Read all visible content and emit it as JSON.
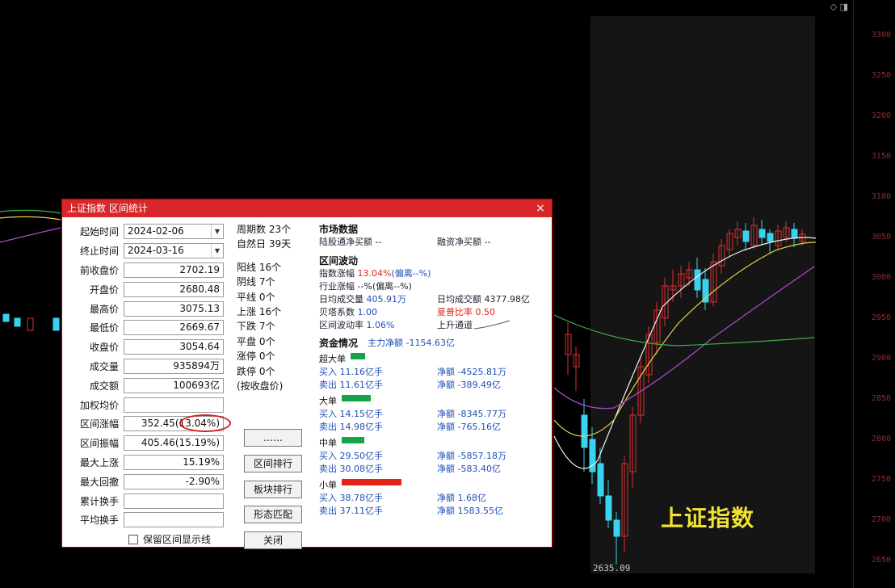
{
  "dialog": {
    "title": "上证指数 区间统计",
    "close_icon": "×",
    "fields": [
      {
        "label": "起始时间",
        "value": "2024-02-06",
        "type": "date"
      },
      {
        "label": "终止时间",
        "value": "2024-03-16",
        "type": "date"
      },
      {
        "label": "前收盘价",
        "value": "2702.19"
      },
      {
        "label": "开盘价",
        "value": "2680.48"
      },
      {
        "label": "最高价",
        "value": "3075.13"
      },
      {
        "label": "最低价",
        "value": "2669.67"
      },
      {
        "label": "收盘价",
        "value": "3054.64"
      },
      {
        "label": "成交量",
        "value": "935894万"
      },
      {
        "label": "成交额",
        "value": "100693亿"
      },
      {
        "label": "加权均价",
        "value": ""
      },
      {
        "label": "区间涨幅",
        "value": "352.45(13.04%)",
        "highlight": true
      },
      {
        "label": "区间振幅",
        "value": "405.46(15.19%)"
      },
      {
        "label": "最大上涨",
        "value": "15.19%"
      },
      {
        "label": "最大回撤",
        "value": "-2.90%"
      },
      {
        "label": "累计换手",
        "value": ""
      },
      {
        "label": "平均换手",
        "value": ""
      }
    ],
    "checkbox_label": "保留区间显示线",
    "stats_top": [
      "周期数 23个",
      "自然日 39天"
    ],
    "stats_bottom": [
      "阳线 16个",
      "阴线 7个",
      "平线 0个",
      "上涨 16个",
      "下跌 7个",
      "平盘 0个",
      "涨停 0个",
      "跌停 0个",
      "(按收盘价)"
    ],
    "buttons": [
      "……",
      "区间排行",
      "板块排行",
      "形态匹配",
      "关闭"
    ],
    "market": {
      "title": "市场数据",
      "row1_a": "陆股通净买额 --",
      "row1_b": "融资净买额 --",
      "vol_title": "区间波动",
      "vol_rows": [
        {
          "a_label": "指数涨幅 ",
          "a_val": "13.04%",
          "a_rest": "(偏离--%)",
          "b": ""
        },
        {
          "a_label": "行业涨幅 --%(偏离--%)",
          "a_val": "",
          "a_rest": "",
          "b": ""
        },
        {
          "a_label": "日均成交量 ",
          "a_val": "405.91万",
          "a_rest": "",
          "b": "日均成交额 4377.98亿"
        },
        {
          "a_label": "贝塔系数 ",
          "a_val": "1.00",
          "a_rest": "",
          "b": "夏普比率 0.50"
        },
        {
          "a_label": "区间波动率 ",
          "a_val": "1.06%",
          "a_rest": "",
          "b": "上升通道"
        }
      ],
      "fund_title": "资金情况",
      "fund_main": "主力净额 -1154.63亿",
      "fund_groups": [
        {
          "name": "超大单",
          "bar_color": "#17a34a",
          "bar_width": 18,
          "buy": "买入 11.16亿手",
          "sell": "卖出 11.61亿手",
          "net1": "净额 -4525.81万",
          "net2": "净额 -389.49亿"
        },
        {
          "name": "大单",
          "bar_color": "#17a34a",
          "bar_width": 36,
          "buy": "买入 14.15亿手",
          "sell": "卖出 14.98亿手",
          "net1": "净额 -8345.77万",
          "net2": "净额 -765.16亿"
        },
        {
          "name": "中单",
          "bar_color": "#17a34a",
          "bar_width": 28,
          "buy": "买入 29.50亿手",
          "sell": "卖出 30.08亿手",
          "net1": "净额 -5857.18万",
          "net2": "净额 -583.40亿"
        },
        {
          "name": "小单",
          "bar_color": "#e2231a",
          "bar_width": 74,
          "buy": "买入 38.78亿手",
          "sell": "卖出 37.11亿手",
          "net1": "净额 1.68亿",
          "net2": "净额 1583.55亿"
        }
      ]
    }
  },
  "chart": {
    "index_name": "上证指数",
    "low_marker": "2635.09",
    "price_ticks": [
      "3300",
      "3250",
      "3200",
      "3150",
      "3100",
      "3050",
      "3000",
      "2950",
      "2900",
      "2850",
      "2800",
      "2750",
      "2700",
      "2650"
    ],
    "colors": {
      "up": "#e03030",
      "down": "#37d3f0",
      "ma1": "#f2f2f2",
      "ma2": "#e8d24a",
      "ma3": "#b04ad0",
      "ma4": "#3bb04a"
    }
  }
}
